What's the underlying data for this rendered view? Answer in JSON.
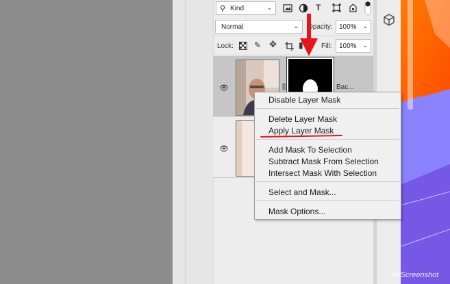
{
  "toolbar": {
    "filter_kind": "Kind",
    "blend_mode": "Normal",
    "opacity_label": "Opacity:",
    "opacity_value": "100%",
    "lock_label": "Lock:",
    "fill_label": "Fill:",
    "fill_value": "100%"
  },
  "layers": [
    {
      "name": "Bac...",
      "visible": true,
      "has_mask": true
    },
    {
      "name": "",
      "visible": true,
      "has_mask": false
    }
  ],
  "context_menu": {
    "items": [
      "Disable Layer Mask",
      "Delete Layer Mask",
      "Apply Layer Mask",
      "Add Mask To Selection",
      "Subtract Mask From Selection",
      "Intersect Mask With Selection",
      "Select and Mask...",
      "Mask Options..."
    ]
  },
  "watermark": "JetScreenshot",
  "colors": {
    "arrow_red": "#e8141b",
    "underline_red": "#e8141b",
    "menu_bg": "#f0f0f0",
    "panel_bg": "#ededed"
  }
}
